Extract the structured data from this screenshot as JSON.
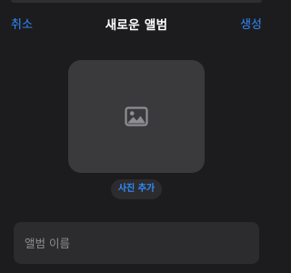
{
  "nav": {
    "cancel_label": "취소",
    "title": "새로운 앨범",
    "create_label": "생성"
  },
  "cover": {
    "icon": "photo-icon",
    "add_photo_label": "사진 추가"
  },
  "album_name": {
    "placeholder": "앨범 이름",
    "value": ""
  },
  "colors": {
    "background": "#1c1c1e",
    "accent": "#2f8bff",
    "surface": "#2c2c2e",
    "thumbnail": "#3a3a3c",
    "placeholder_text": "#8e8e93"
  }
}
